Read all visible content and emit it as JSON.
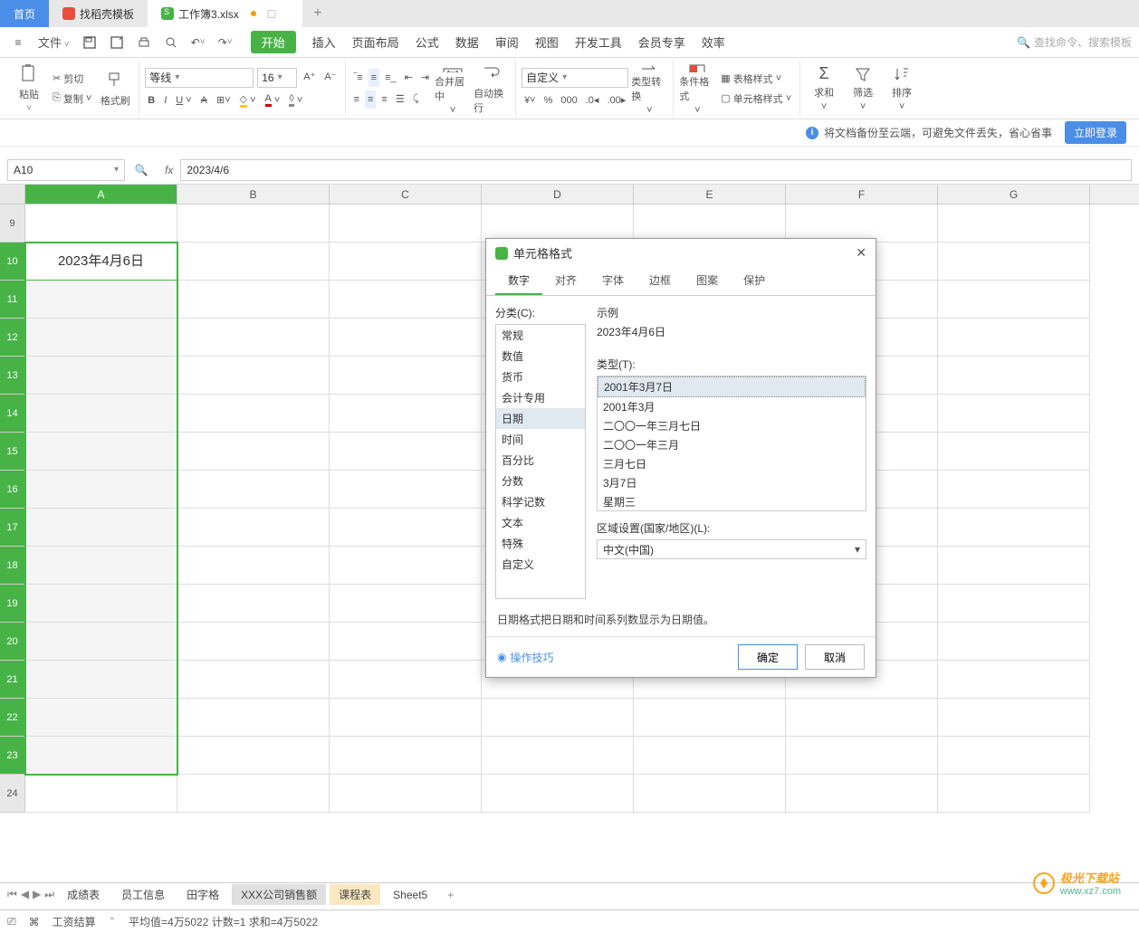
{
  "top_tabs": {
    "home": "首页",
    "template": "找稻壳模板",
    "file": "工作簿3.xlsx"
  },
  "menu": {
    "file_menu": "文件",
    "tabs": [
      "开始",
      "插入",
      "页面布局",
      "公式",
      "数据",
      "审阅",
      "视图",
      "开发工具",
      "会员专享",
      "效率"
    ],
    "search_placeholder": "查找命令、搜索模板"
  },
  "ribbon": {
    "paste": "粘贴",
    "cut": "剪切",
    "copy": "复制",
    "format_painter": "格式刷",
    "font_name": "等线",
    "font_size": "16",
    "merge_center": "合并居中",
    "auto_wrap": "自动换行",
    "number_format": "自定义",
    "type_convert": "类型转换",
    "conditional_format": "条件格式",
    "table_style": "表格样式",
    "cell_style": "单元格样式",
    "sum": "求和",
    "filter": "筛选",
    "sort": "排序"
  },
  "backup": {
    "message": "将文档备份至云端，可避免文件丢失，省心省事",
    "login": "立即登录"
  },
  "formula_bar": {
    "cell_ref": "A10",
    "formula": "2023/4/6"
  },
  "grid": {
    "columns": [
      "A",
      "B",
      "C",
      "D",
      "E",
      "F",
      "G"
    ],
    "row_labels": [
      "9",
      "10",
      "11",
      "12",
      "13",
      "14",
      "15",
      "16",
      "17",
      "18",
      "19",
      "20",
      "21",
      "22",
      "23",
      "24"
    ],
    "active_cell_value": "2023年4月6日"
  },
  "dialog": {
    "title": "单元格格式",
    "tabs": [
      "数字",
      "对齐",
      "字体",
      "边框",
      "图案",
      "保护"
    ],
    "category_label": "分类(C):",
    "categories": [
      "常规",
      "数值",
      "货币",
      "会计专用",
      "日期",
      "时间",
      "百分比",
      "分数",
      "科学记数",
      "文本",
      "特殊",
      "自定义"
    ],
    "sample_label": "示例",
    "sample_value": "2023年4月6日",
    "type_label": "类型(T):",
    "types": [
      "2001年3月7日",
      "2001年3月",
      "二〇〇一年三月七日",
      "二〇〇一年三月",
      "三月七日",
      "3月7日",
      "星期三"
    ],
    "locale_label": "区域设置(国家/地区)(L):",
    "locale_value": "中文(中国)",
    "note": "日期格式把日期和时间系列数显示为日期值。",
    "tips": "操作技巧",
    "ok": "确定",
    "cancel": "取消"
  },
  "sheets": {
    "tabs": [
      "成绩表",
      "员工信息",
      "田字格",
      "XXX公司销售额",
      "课程表",
      "Sheet5"
    ]
  },
  "status": {
    "calc": "工资结算",
    "stats": "平均值=4万5022  计数=1  求和=4万5022"
  },
  "watermark": {
    "cn": "极光下载站",
    "url": "www.xz7.com"
  }
}
